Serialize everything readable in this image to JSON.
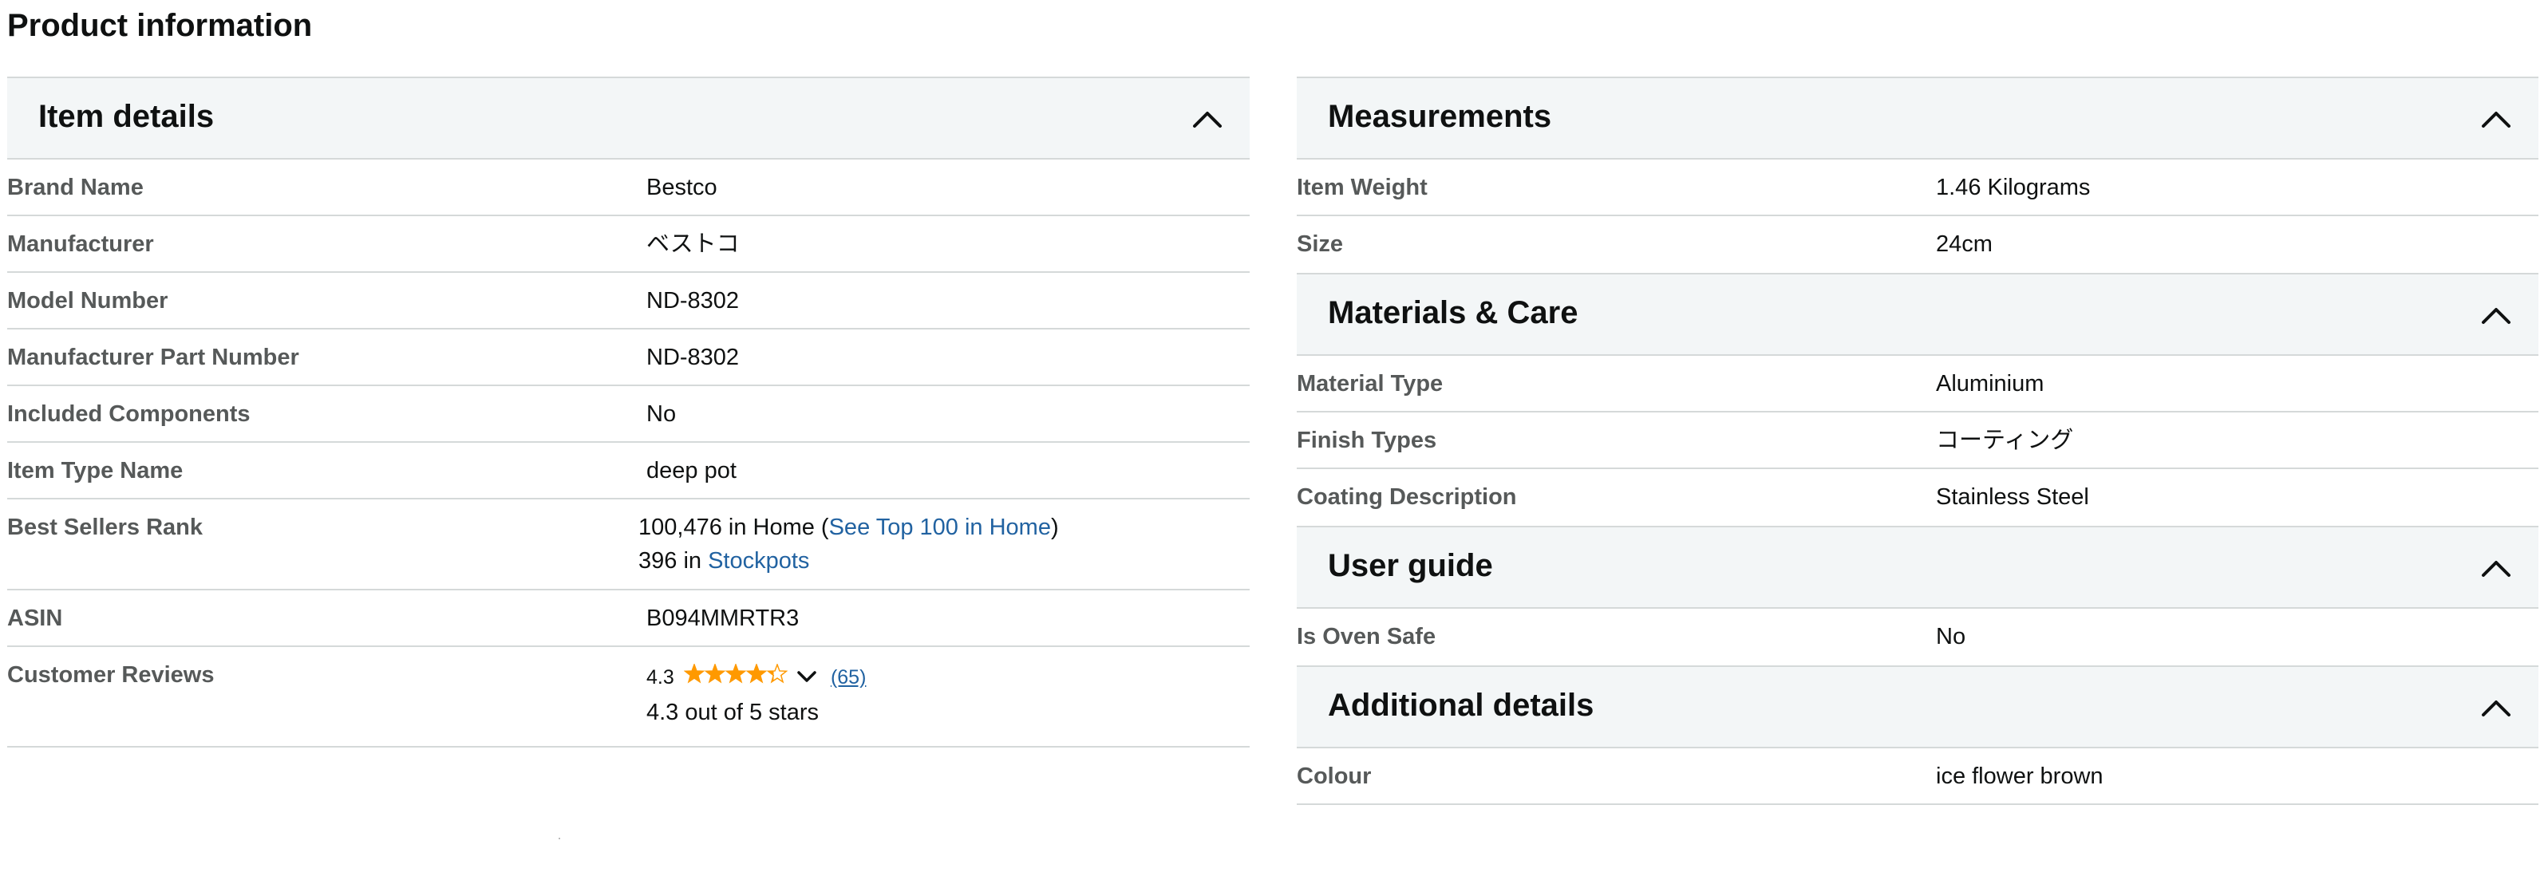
{
  "page_title": "Product information",
  "colors": {
    "accent_link": "#2162a1",
    "star": "#ff9900",
    "header_bg": "#f3f6f7",
    "divider": "#d5d9d9",
    "label": "#565959"
  },
  "item_details": {
    "title": "Item details",
    "rows": [
      {
        "label": "Brand Name",
        "value": "Bestco"
      },
      {
        "label": "Manufacturer",
        "value": "ベストコ"
      },
      {
        "label": "Model Number",
        "value": "ND-8302"
      },
      {
        "label": "Manufacturer Part Number",
        "value": "ND-8302"
      },
      {
        "label": "Included Components",
        "value": "No"
      },
      {
        "label": "Item Type Name",
        "value": "deep pot"
      }
    ],
    "best_sellers": {
      "label": "Best Sellers Rank",
      "rank1_prefix": "100,476 in Home (",
      "rank1_link": "See Top 100 in Home",
      "rank1_suffix": ")",
      "rank2_prefix": "396 in ",
      "rank2_link": "Stockpots"
    },
    "asin": {
      "label": "ASIN",
      "value": "B094MMRTR3"
    },
    "reviews": {
      "label": "Customer Reviews",
      "rating": "4.3",
      "rating_value": 4.3,
      "count_link": "(65)",
      "summary": "4.3 out of 5 stars"
    }
  },
  "measurements": {
    "title": "Measurements",
    "rows": [
      {
        "label": "Item Weight",
        "value": "1.46 Kilograms"
      },
      {
        "label": "Size",
        "value": "24cm"
      }
    ]
  },
  "materials_care": {
    "title": "Materials & Care",
    "rows": [
      {
        "label": "Material Type",
        "value": "Aluminium"
      },
      {
        "label": "Finish Types",
        "value": "コーティング"
      },
      {
        "label": "Coating Description",
        "value": "Stainless Steel"
      }
    ]
  },
  "user_guide": {
    "title": "User guide",
    "rows": [
      {
        "label": "Is Oven Safe",
        "value": "No"
      }
    ]
  },
  "additional_details": {
    "title": "Additional details",
    "rows": [
      {
        "label": "Colour",
        "value": "ice flower brown"
      }
    ]
  }
}
